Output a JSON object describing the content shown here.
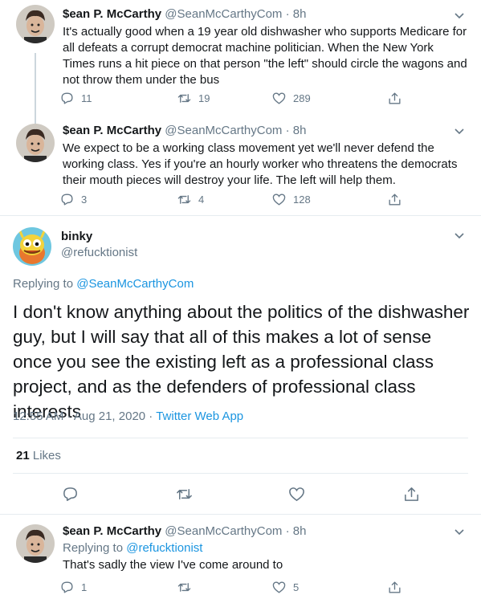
{
  "tweets": [
    {
      "name": "$ean P. McCarthy",
      "handle": "@SeanMcCarthyCom",
      "time": "8h",
      "text": "It's actually good when a 19 year old dishwasher who supports Medicare for all defeats a corrupt democrat machine politician. When the New York Times runs a hit piece on that person \"the left\" should circle the wagons and not throw them under the bus",
      "replies": "11",
      "retweets": "19",
      "likes": "289"
    },
    {
      "name": "$ean P. McCarthy",
      "handle": "@SeanMcCarthyCom",
      "time": "8h",
      "text": "We expect to be a working class movement yet we'll never defend the working class. Yes if you're an hourly worker who threatens the democrats their mouth pieces will destroy your life. The left will help them.",
      "replies": "3",
      "retweets": "4",
      "likes": "128"
    }
  ],
  "focus": {
    "name": "binky",
    "handle": "@refucktionist",
    "replying_prefix": "Replying to",
    "replying_to": "@SeanMcCarthyCom",
    "text": "I don't know anything about the politics of the dishwasher guy, but I will say that all of this makes a lot of sense once you see the existing left as a professional class project, and as the defenders of professional class interests",
    "timestamp": "12:55 AM · Aug 21, 2020 · ",
    "source": "Twitter Web App",
    "likes_count": "21",
    "likes_label": "Likes"
  },
  "reply": {
    "name": "$ean P. McCarthy",
    "handle": "@SeanMcCarthyCom",
    "time": "8h",
    "replying_prefix": "Replying to",
    "replying_to": "@refucktionist",
    "text": "That's sadly the view I've come around to",
    "replies": "1",
    "retweets": "",
    "likes": "5"
  },
  "dot_separator": "·",
  "colors": {
    "link": "#1b95e0",
    "muted": "#657786",
    "divider": "#e6ecf0"
  }
}
